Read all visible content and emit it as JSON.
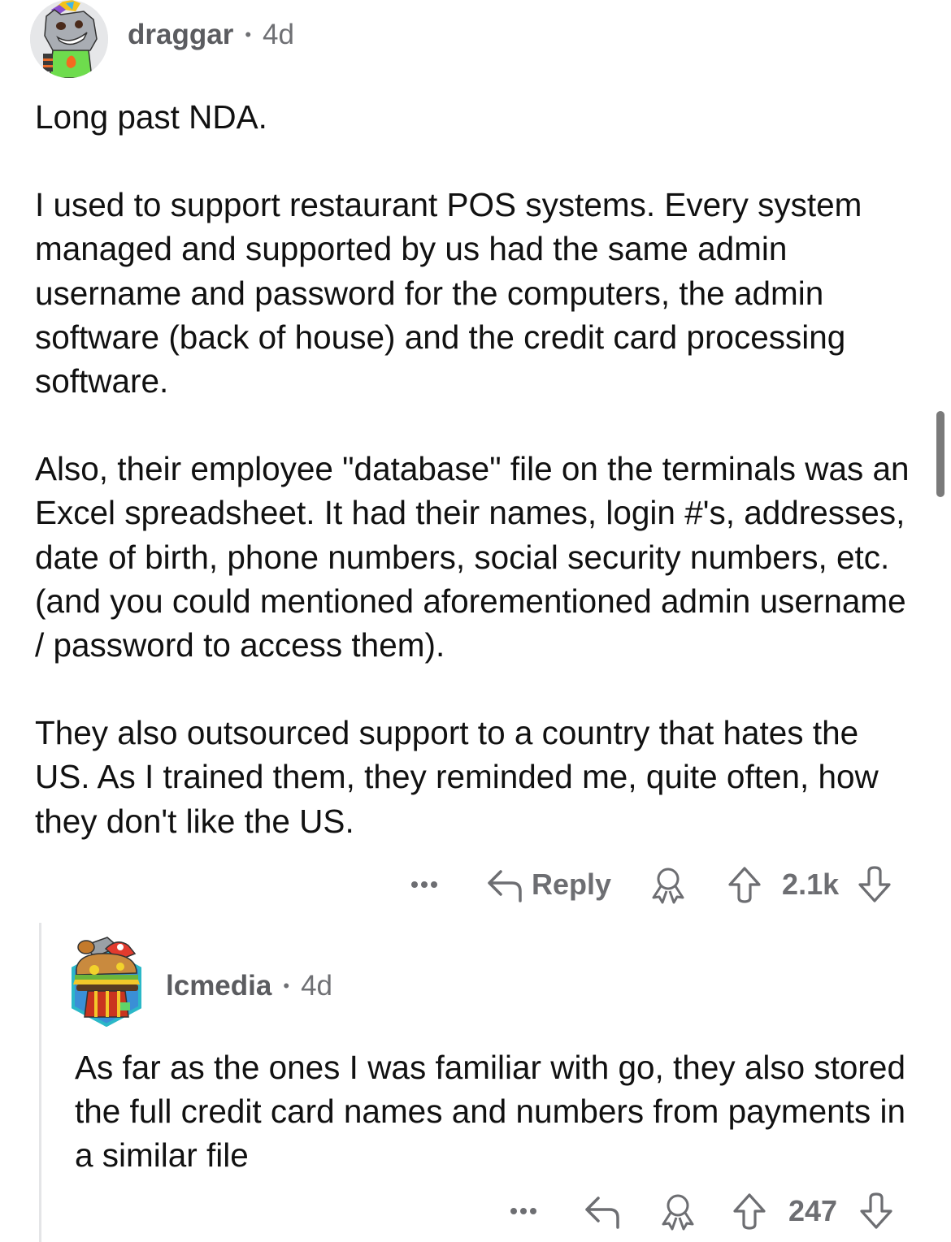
{
  "comments": [
    {
      "username": "draggar",
      "separator": "•",
      "age": "4d",
      "avatar_icon": "wolf-avatar-icon",
      "paragraphs": [
        "Long past NDA.",
        "I used to support restaurant POS systems.  Every system managed and supported by us had the same admin username and password for the computers, the admin software (back of house) and the credit card processing software.",
        "Also, their employee \"database\" file on the terminals was an Excel spreadsheet.  It had their names, login #'s, addresses, date of birth, phone numbers, social security numbers, etc. (and you could mentioned aforementioned admin username / password to access them).",
        "They also outsourced support to a country that hates the US.  As I trained them, they reminded me, quite often, how they don't like the US."
      ],
      "actions": {
        "more_icon": "more-dots-icon",
        "reply_label": "Reply",
        "award_icon": "award-icon",
        "upvote_icon": "upvote-arrow-icon",
        "score": "2.1k",
        "downvote_icon": "downvote-arrow-icon"
      }
    },
    {
      "username": "lcmedia",
      "separator": "•",
      "age": "4d",
      "avatar_icon": "burger-avatar-icon",
      "paragraphs": [
        "As far as the ones I was familiar with go, they also stored the full credit card names and numbers from payments in a similar file"
      ],
      "actions": {
        "more_icon": "more-dots-icon",
        "reply_label": "",
        "award_icon": "award-icon",
        "upvote_icon": "upvote-arrow-icon",
        "score": "247",
        "downvote_icon": "downvote-arrow-icon"
      }
    }
  ],
  "colors": {
    "meta_text": "#6f7074",
    "body_text": "#111111",
    "action_gray": "#6d6e72",
    "thread_line": "#e4e5e7"
  }
}
